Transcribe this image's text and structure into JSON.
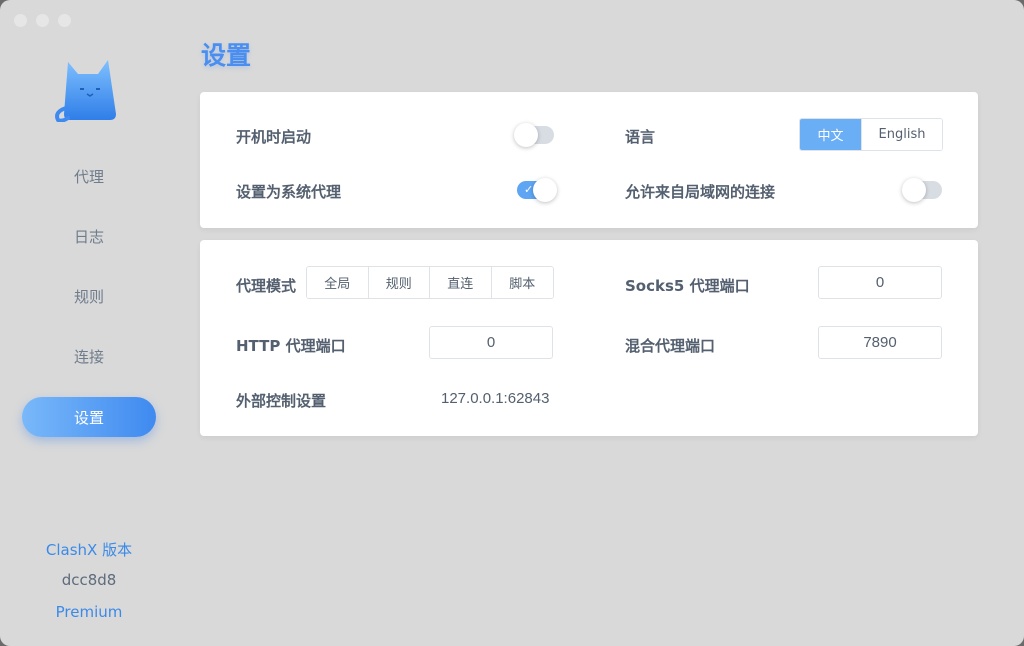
{
  "page": {
    "title": "设置"
  },
  "sidebar": {
    "items": [
      {
        "label": "代理"
      },
      {
        "label": "日志"
      },
      {
        "label": "规则"
      },
      {
        "label": "连接"
      },
      {
        "label": "设置"
      }
    ],
    "version_label": "ClashX 版本",
    "version_hash": "dcc8d8",
    "version_edition": "Premium"
  },
  "general": {
    "start_at_login": {
      "label": "开机时启动",
      "on": false
    },
    "system_proxy": {
      "label": "设置为系统代理",
      "on": true
    },
    "language": {
      "label": "语言",
      "options": [
        "中文",
        "English"
      ],
      "selected": "中文"
    },
    "allow_lan": {
      "label": "允许来自局域网的连接",
      "on": false
    }
  },
  "proxy": {
    "mode": {
      "label": "代理模式",
      "options": [
        "全局",
        "规则",
        "直连",
        "脚本"
      ]
    },
    "socks5_port": {
      "label": "Socks5 代理端口",
      "value": "0"
    },
    "http_port": {
      "label": "HTTP 代理端口",
      "value": "0"
    },
    "mixed_port": {
      "label": "混合代理端口",
      "value": "7890"
    },
    "external_controller": {
      "label": "外部控制设置",
      "value": "127.0.0.1:62843"
    }
  },
  "colors": {
    "accent": "#4a8ff0",
    "toggle_on": "#5ea5f3",
    "text": "#54606f"
  }
}
